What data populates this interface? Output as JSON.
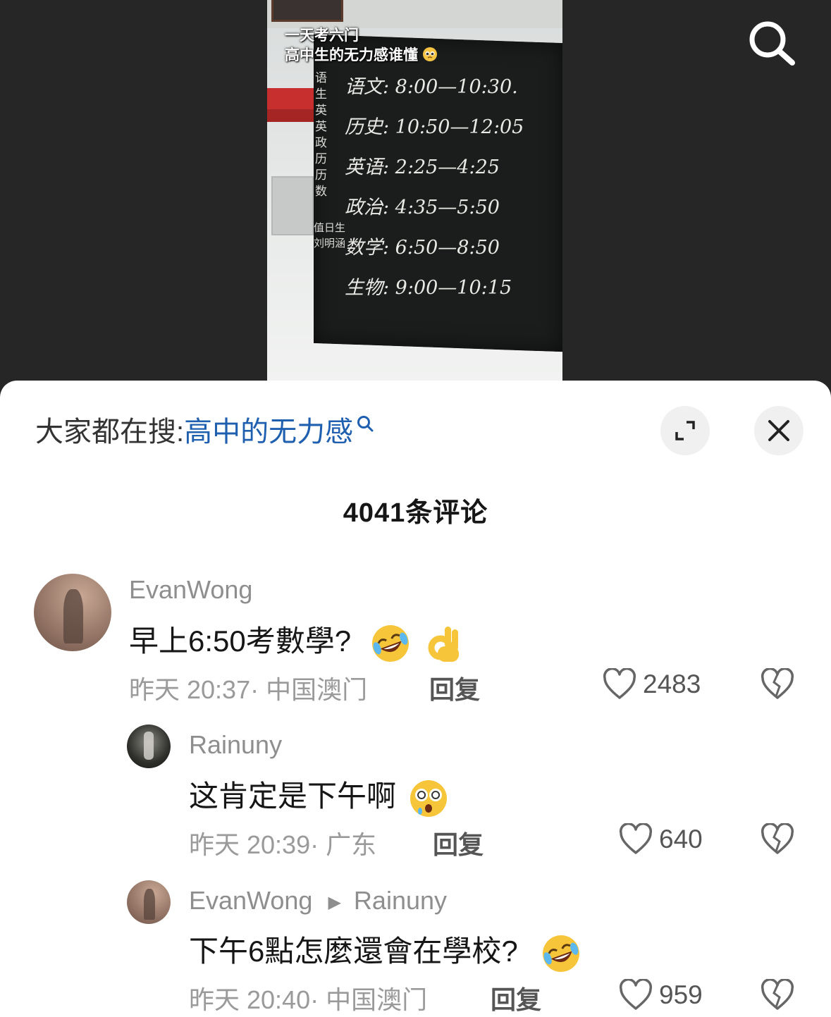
{
  "video": {
    "caption_line1": "一天考六门",
    "caption_line2": "高中生的无力感谁懂",
    "board_lines": [
      "语文: 8:00—10:30.",
      "历史: 10:50—12:05",
      "英语: 2:25—4:25",
      "政治: 4:35—5:50",
      "数学: 6:50—8:50",
      "生物: 9:00—10:15"
    ],
    "board_side_chars": "语\n生\n英\n英\n政\n历\n历\n数",
    "board_side_names": "值日生\n刘明涵",
    "search_icon": "search-icon"
  },
  "sheet": {
    "hot_search_prefix": "大家都在搜:",
    "hot_search_keyword": "高中的无力感",
    "comment_count": "4041条评论"
  },
  "comments": [
    {
      "user": "EvanWong",
      "text": "早上6:50考數學?",
      "emojis": [
        "rolling-laughing-emoji",
        "ok-hand-emoji"
      ],
      "time_location": "昨天 20:37· 中国澳门",
      "reply_label": "回复",
      "likes": "2483"
    },
    {
      "user": "Rainuny",
      "text": "这肯定是下午啊",
      "emojis": [
        "dizzy-face-emoji"
      ],
      "time_location": "昨天 20:39· 广东",
      "reply_label": "回复",
      "likes": "640"
    },
    {
      "user": "EvanWong",
      "reply_to": "Rainuny",
      "text": "下午6點怎麼還會在學校?",
      "emojis": [
        "rolling-laughing-emoji"
      ],
      "time_location": "昨天 20:40· 中国澳门",
      "reply_label": "回复",
      "likes": "959"
    }
  ],
  "colors": {
    "keyword": "#1f5fb0",
    "meta_gray": "#9a9a9a",
    "text": "#161616"
  }
}
